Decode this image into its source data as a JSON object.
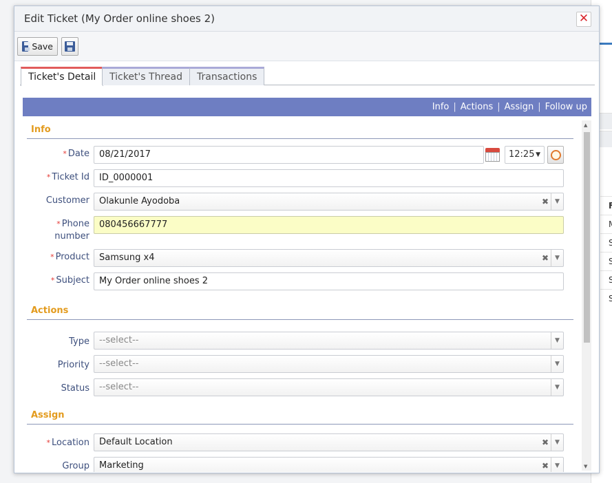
{
  "dialog": {
    "title": "Edit Ticket (My Order online shoes 2)",
    "close_symbol": "✕"
  },
  "toolbar": {
    "save_label": "Save",
    "save_icon": "floppy-disk-icon",
    "save_close_icon": "save-and-close-icon"
  },
  "tabs": [
    {
      "label": "Ticket's Detail",
      "active": true
    },
    {
      "label": "Ticket's Thread",
      "active": false
    },
    {
      "label": "Transactions",
      "active": false
    }
  ],
  "infobar": {
    "links": [
      "Info",
      "Actions",
      "Assign",
      "Follow up"
    ],
    "separator": "|",
    "color": "#6e7ec2"
  },
  "sections": {
    "info": "Info",
    "actions": "Actions",
    "assign": "Assign"
  },
  "form": {
    "required_mark": "*",
    "date": {
      "label": "Date",
      "value": "08/21/2017",
      "time": "12:25"
    },
    "ticket_id": {
      "label": "Ticket Id",
      "value": "ID_0000001"
    },
    "customer": {
      "label": "Customer",
      "value": "Olakunle Ayodoba"
    },
    "phone": {
      "label_line1": "Phone",
      "label_line2": "number",
      "value": "080456667777"
    },
    "product": {
      "label": "Product",
      "value": "Samsung x4"
    },
    "subject": {
      "label": "Subject",
      "value": "My Order online shoes 2"
    },
    "type": {
      "label": "Type",
      "placeholder": "--select--"
    },
    "priority": {
      "label": "Priority",
      "placeholder": "--select--"
    },
    "status": {
      "label": "Status",
      "placeholder": "--select--"
    },
    "location": {
      "label": "Location",
      "value": "Default Location"
    },
    "group": {
      "label": "Group",
      "value": "Marketing"
    },
    "clear_symbol": "✖",
    "dropdown_symbol": "▼"
  },
  "background": {
    "row_letters": [
      "F",
      "M",
      "S",
      "S",
      "S",
      "S"
    ]
  },
  "colors": {
    "section_title": "#e39b1e",
    "label": "#3d4f7d",
    "required": "#e53935",
    "highlight_field": "#fbfdc6",
    "close": "#d9242a"
  }
}
